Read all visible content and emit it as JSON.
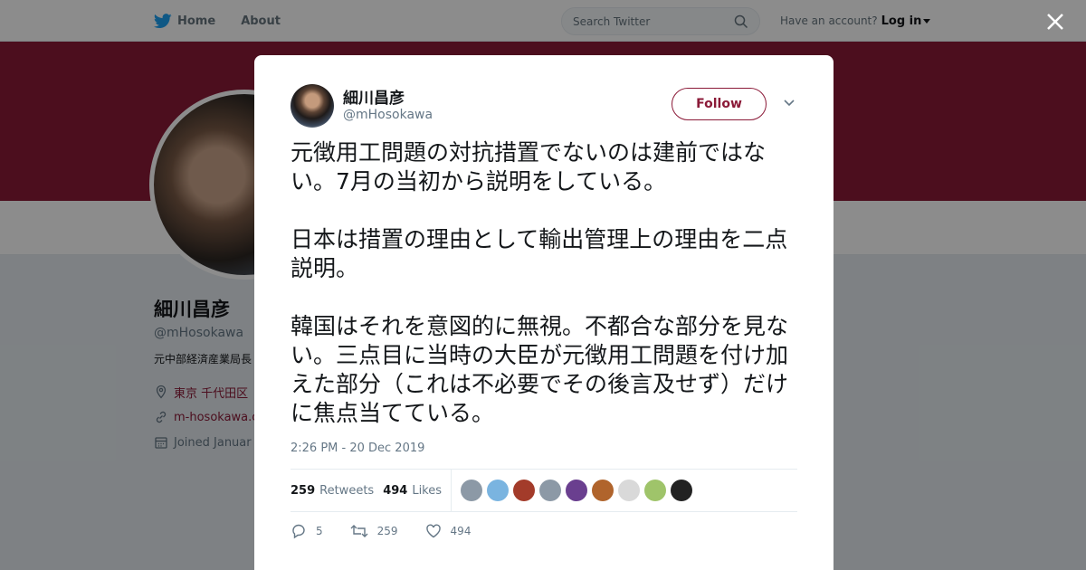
{
  "nav": {
    "home_label": "Home",
    "about_label": "About",
    "search_placeholder": "Search Twitter",
    "have_account": "Have an account?",
    "login_label": "Log in"
  },
  "colors": {
    "brand": "#8b1a38",
    "twitter_blue": "#1da1f2"
  },
  "profile": {
    "name": "細川昌彦",
    "handle": "@mHosokawa",
    "bio": "元中部経済産業局長 教授。細川昌彦の",
    "location": "東京 千代田区",
    "url": "m-hosokawa.c",
    "joined": "Joined Januar"
  },
  "tweet": {
    "author_name": "細川昌彦",
    "author_handle": "@mHosokawa",
    "follow_label": "Follow",
    "paragraphs": [
      "元徴用工問題の対抗措置でないのは建前ではない。7月の当初から説明をしている。",
      "日本は措置の理由として輸出管理上の理由を二点説明。",
      "韓国はそれを意図的に無視。不都合な部分を見ない。三点目に当時の大臣が元徴用工問題を付け加えた部分（これは不必要でその後言及せず）だけに焦点当てている。"
    ],
    "timestamp": "2:26 PM - 20 Dec 2019",
    "retweets_count": "259",
    "retweets_label": "Retweets",
    "likes_count": "494",
    "likes_label": "Likes",
    "reply_count": "5",
    "retweet_action_count": "259",
    "like_action_count": "494",
    "liker_avatar_colors": [
      "#8c99a6",
      "#7ab4e0",
      "#a33b2a",
      "#8c99a6",
      "#6a3f8f",
      "#b0642c",
      "#d9d9d9",
      "#9fc46a",
      "#222222"
    ]
  }
}
